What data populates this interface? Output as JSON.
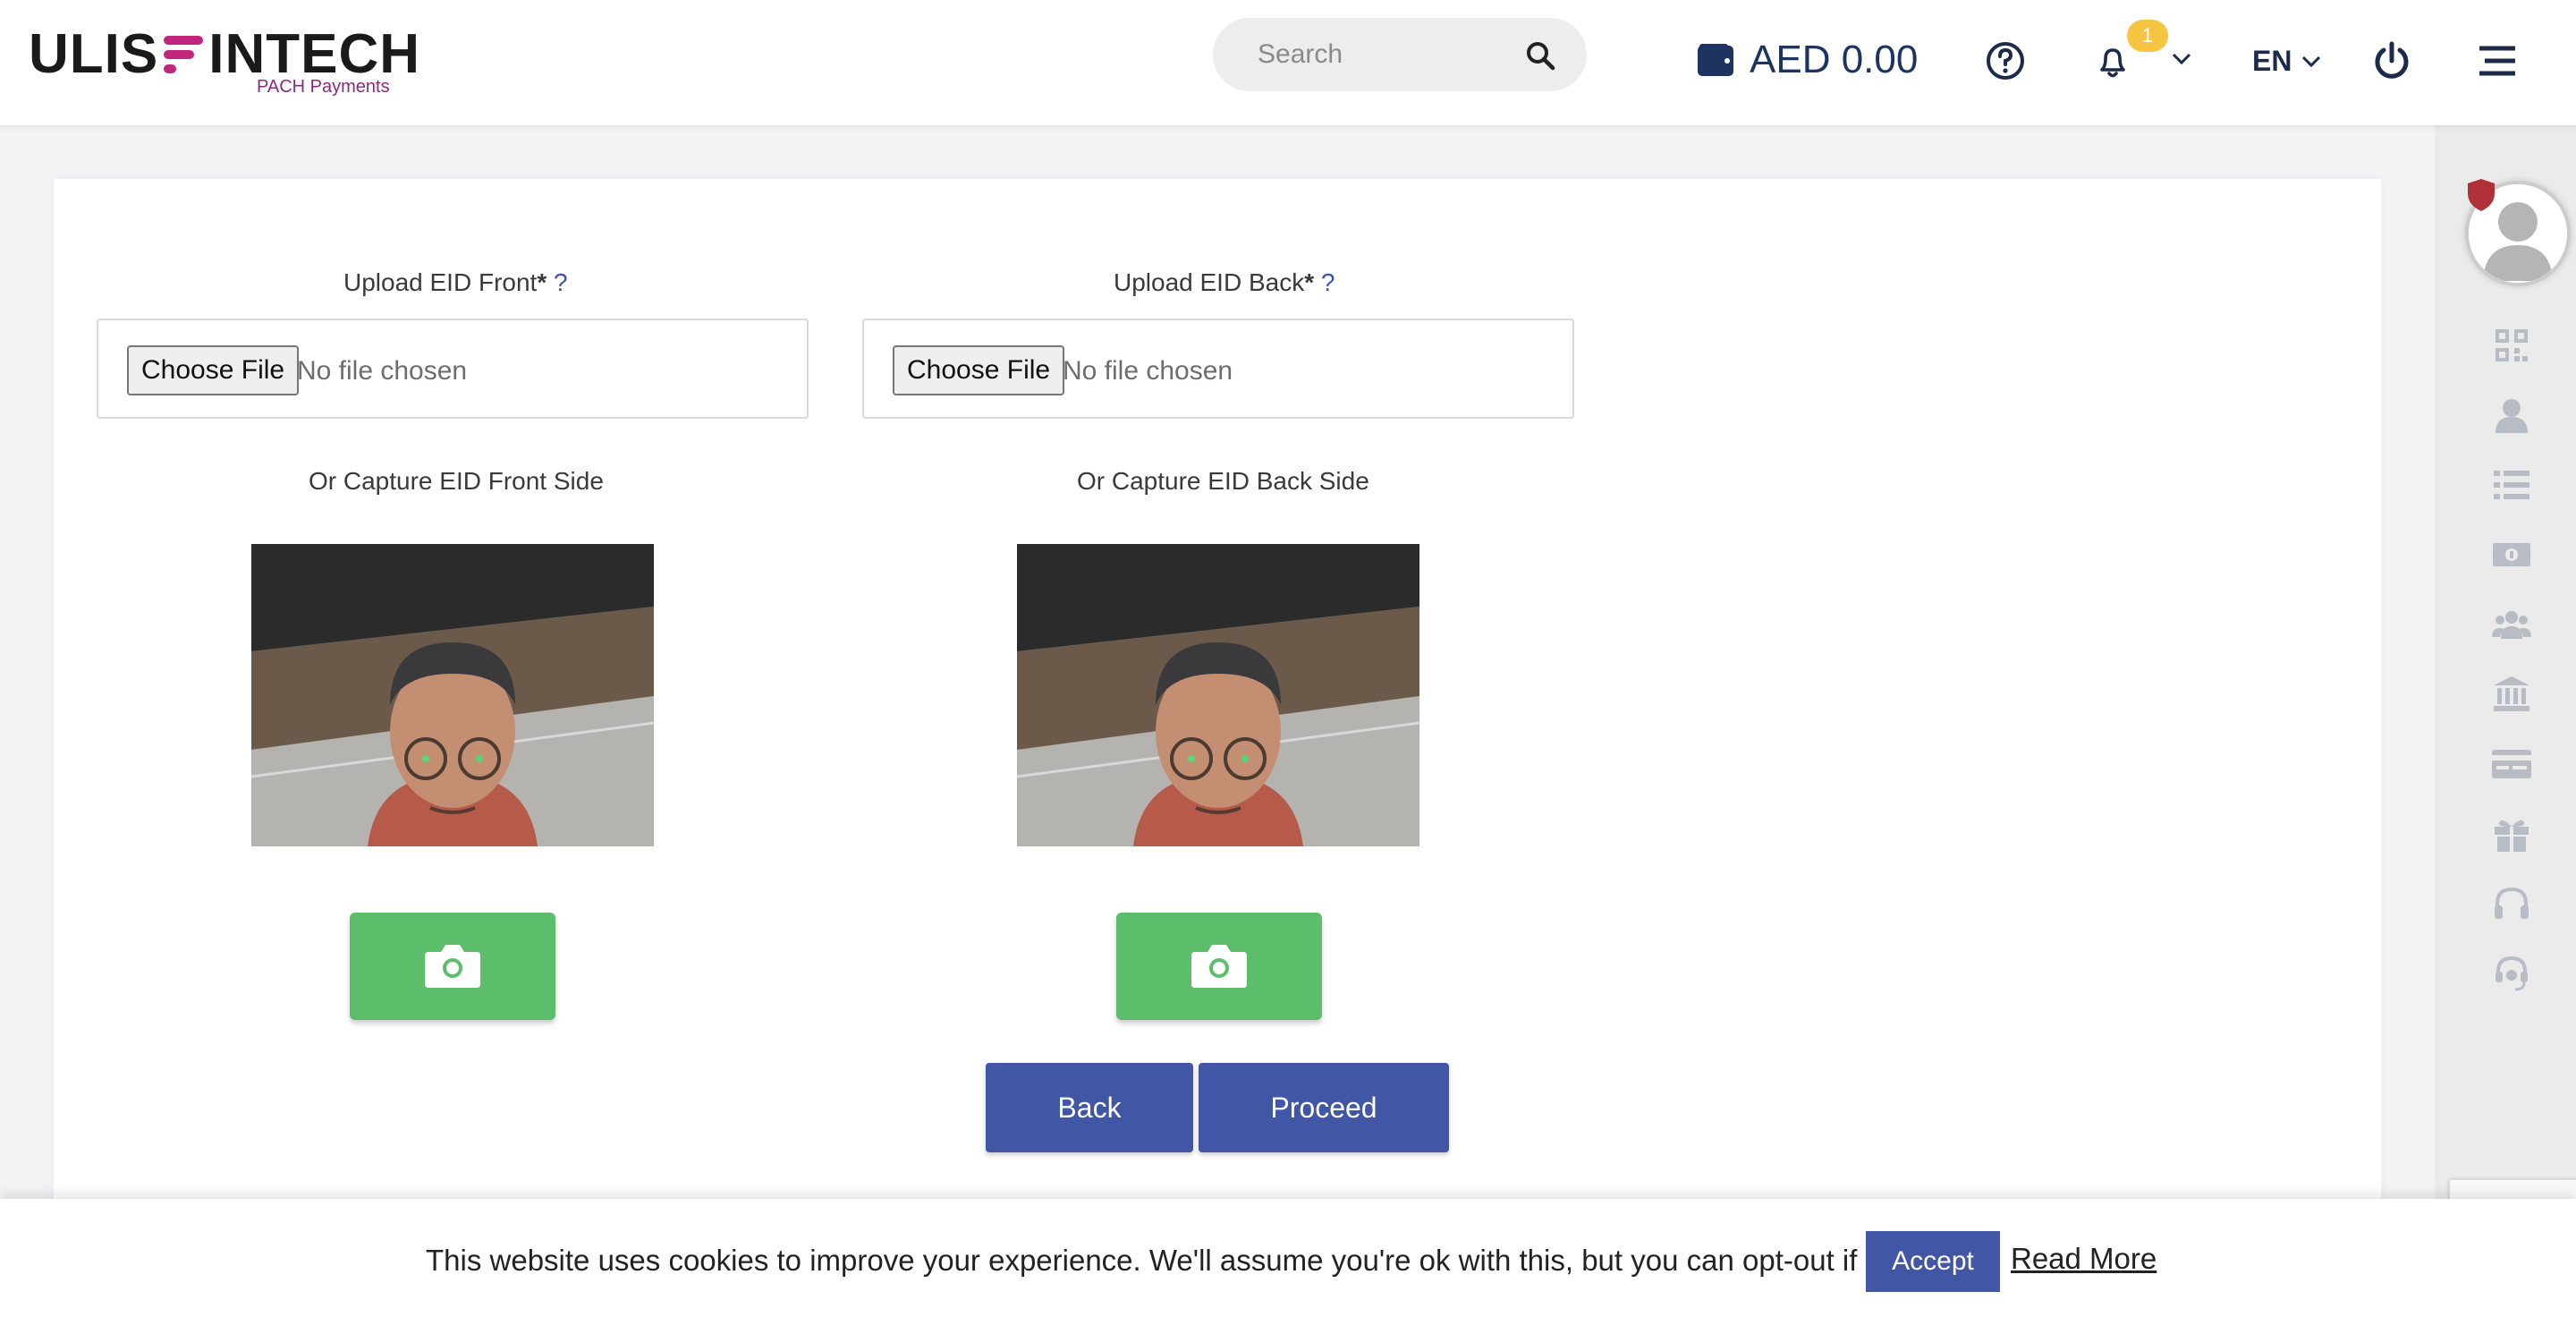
{
  "header": {
    "logo_text_left": "ULIS",
    "logo_text_right": "INTECH",
    "logo_subtitle": "PACH Payments",
    "search_placeholder": "Search",
    "wallet_amount": "AED 0.00",
    "notification_count": "1",
    "language": "EN",
    "icons": [
      "search-icon",
      "wallet-icon",
      "help-icon",
      "bell-icon",
      "chevron-down-icon",
      "power-icon",
      "menu-icon"
    ]
  },
  "sidebar": {
    "icons": [
      "qr-code-icon",
      "user-icon",
      "list-icon",
      "money-icon",
      "users-icon",
      "bank-icon",
      "card-icon",
      "gift-icon",
      "headphones-icon",
      "support-icon"
    ]
  },
  "form": {
    "front": {
      "upload_label": "Upload EID Front",
      "required_mark": "*",
      "help_mark": "?",
      "choose_label": "Choose File",
      "no_file": "No file chosen",
      "capture_label": "Or Capture EID Front Side"
    },
    "back": {
      "upload_label": "Upload EID Back",
      "required_mark": "*",
      "help_mark": "?",
      "choose_label": "Choose File",
      "no_file": "No file chosen",
      "capture_label": "Or Capture EID Back Side"
    },
    "back_button": "Back",
    "proceed_button": "Proceed"
  },
  "cookie": {
    "message": "This website uses cookies to improve your experience. We'll assume you're ok with this, but you can opt-out if you wish.",
    "accept_label": "Accept",
    "read_more_label": "Read More"
  },
  "colors": {
    "primary": "#4256a6",
    "camera_button": "#5cbd6b",
    "brand_accent": "#c0267d",
    "badge": "#f5c542"
  }
}
